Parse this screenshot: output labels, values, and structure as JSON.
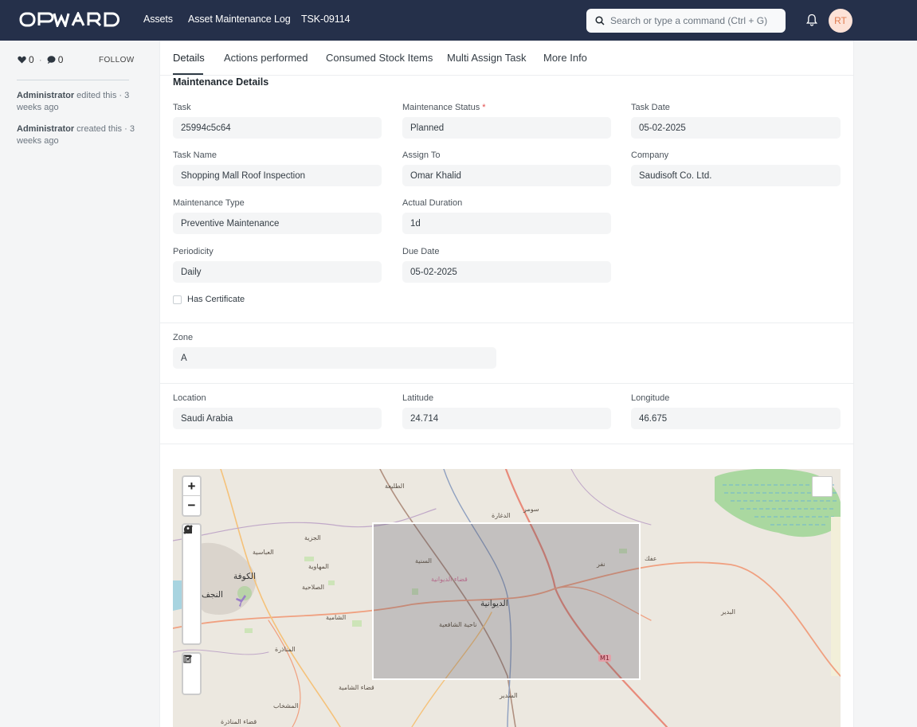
{
  "navbar": {
    "brand": "OPWARD",
    "breadcrumbs": [
      "Assets",
      "Asset Maintenance Log",
      "TSK-09114"
    ],
    "search_placeholder": "Search or type a command (Ctrl + G)",
    "avatar_initials": "RT"
  },
  "sidebar": {
    "likes_count": "0",
    "comments_count": "0",
    "follow_label": "FOLLOW",
    "activity": [
      {
        "user": "Administrator",
        "text": " edited this · 3 weeks ago"
      },
      {
        "user": "Administrator",
        "text": " created this · 3 weeks ago"
      }
    ]
  },
  "tabs": [
    "Details",
    "Actions performed",
    "Consumed Stock Items",
    "Multi Assign Task",
    "More Info"
  ],
  "form": {
    "section_title": "Maintenance Details",
    "task": {
      "label": "Task",
      "value": "25994c5c64"
    },
    "maintenance_status": {
      "label": "Maintenance Status",
      "value": "Planned",
      "required": "*"
    },
    "task_date": {
      "label": "Task Date",
      "value": "05-02-2025"
    },
    "task_name": {
      "label": "Task Name",
      "value": "Shopping Mall Roof Inspection"
    },
    "assign_to": {
      "label": "Assign To",
      "value": "Omar Khalid"
    },
    "company": {
      "label": "Company",
      "value": "Saudisoft Co. Ltd."
    },
    "maintenance_type": {
      "label": "Maintenance Type",
      "value": "Preventive Maintenance"
    },
    "actual_duration": {
      "label": "Actual Duration",
      "value": "1d"
    },
    "periodicity": {
      "label": "Periodicity",
      "value": "Daily"
    },
    "due_date": {
      "label": "Due Date",
      "value": "05-02-2025"
    },
    "has_certificate": {
      "label": "Has Certificate",
      "checked": false
    },
    "zone": {
      "label": "Zone",
      "value": "A"
    },
    "location": {
      "label": "Location",
      "value": "Saudi Arabia"
    },
    "latitude": {
      "label": "Latitude",
      "value": "24.714"
    },
    "longitude": {
      "label": "Longitude",
      "value": "46.675"
    }
  },
  "map": {
    "zoom_in": "+",
    "zoom_out": "−",
    "labels": {
      "taliah": "الطليعة",
      "sumar": "سومر",
      "daghara": "الدغارة",
      "jaziya": "الجزية",
      "abbasiya": "العباسية",
      "kufa": "الكوفة",
      "najaf": "النجف",
      "mahawiya": "المهاوية",
      "salahiya": "الصلاحية",
      "saniyya": "السنية",
      "diwaniya_district": "قضاء الديوانية",
      "diwaniya": "الديوانية",
      "nafar": "نفر",
      "afak": "عفك",
      "shamiya": "الشامية",
      "shafiiya": "ناحية الشافعية",
      "badir": "البدير",
      "manathira": "المناذرة",
      "shamiya_district": "قضاء الشامية",
      "sudair": "السدير",
      "mishkhab": "المشخاب",
      "manathira_district": "قضاء المناذرة",
      "road_m1": "M1"
    }
  },
  "colors": {
    "navbar": "#25304a",
    "accent_required": "#e24c4c",
    "avatar_bg": "#fde2d7",
    "avatar_fg": "#e07c50"
  }
}
